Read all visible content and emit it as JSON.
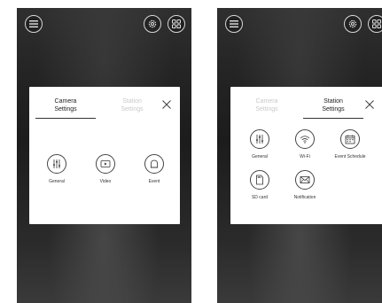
{
  "screens": [
    {
      "tabs": [
        {
          "label_line1": "Camera",
          "label_line2": "Settings",
          "active": true
        },
        {
          "label_line1": "Station",
          "label_line2": "Settings",
          "active": false
        }
      ],
      "items": [
        {
          "label": "General",
          "icon": "sliders-icon"
        },
        {
          "label": "Video",
          "icon": "video-play-icon"
        },
        {
          "label": "Event",
          "icon": "bell-icon"
        }
      ]
    },
    {
      "tabs": [
        {
          "label_line1": "Camera",
          "label_line2": "Settings",
          "active": false
        },
        {
          "label_line1": "Station",
          "label_line2": "Settings",
          "active": true
        }
      ],
      "items": [
        {
          "label": "General",
          "icon": "sliders-icon"
        },
        {
          "label": "Wi-Fi",
          "icon": "wifi-icon"
        },
        {
          "label": "Event Schedule",
          "icon": "calendar-icon"
        },
        {
          "label": "SD card",
          "icon": "sd-card-icon"
        },
        {
          "label": "Notification",
          "icon": "envelope-icon"
        }
      ]
    }
  ],
  "colors": {
    "modal_bg": "#ffffff",
    "active_text": "#222222",
    "inactive_text": "#c9c9c9"
  }
}
